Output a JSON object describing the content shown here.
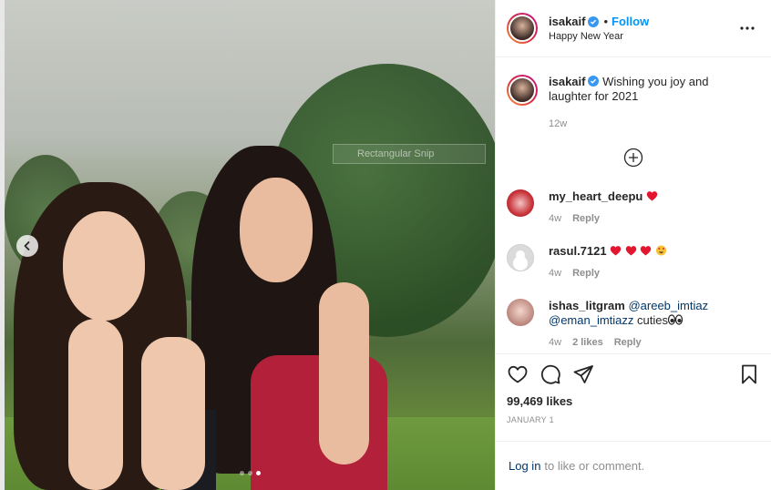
{
  "post": {
    "username": "isakaif",
    "follow_label": "Follow",
    "separator": "•",
    "location": "Happy New Year",
    "caption": "Wishing you joy and laughter for 2021",
    "caption_age": "12w",
    "likes": "99,469 likes",
    "date": "JANUARY 1",
    "overlay_text": "Rectangular Snip"
  },
  "comments": [
    {
      "user": "my_heart_deepu",
      "text": "",
      "emoji": [
        "heart"
      ],
      "age": "4w",
      "likes": "",
      "reply": "Reply"
    },
    {
      "user": "rasul.7121",
      "text": "",
      "emoji": [
        "heart",
        "heart",
        "heart",
        "heart-eyes"
      ],
      "age": "4w",
      "likes": "",
      "reply": "Reply"
    },
    {
      "user": "ishas_litgram",
      "mention1": "@areeb_imtiaz",
      "mention2": "@eman_imtiazz",
      "text": "cuties",
      "age": "4w",
      "likes": "2 likes",
      "reply": "Reply"
    }
  ],
  "footer": {
    "login_link": "Log in",
    "login_text": "to like or comment."
  },
  "colors": {
    "accent": "#0095f6",
    "heart": "#ed4956",
    "mention": "#00376b",
    "muted": "#8e8e8e"
  },
  "carousel": {
    "slides": 3,
    "active": 3
  }
}
